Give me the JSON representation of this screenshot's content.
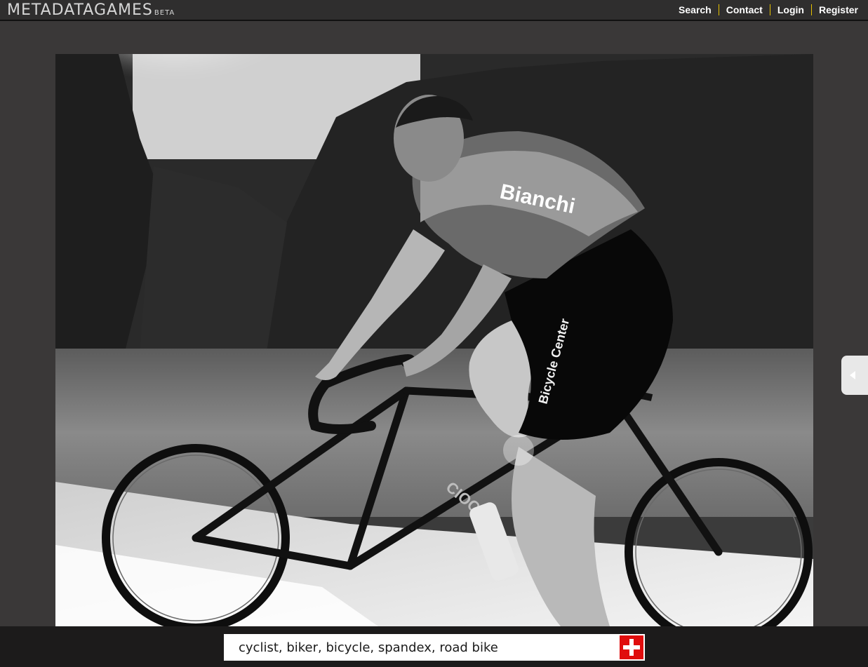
{
  "header": {
    "logo_text": "METADATAGAMES",
    "logo_suffix": "BETA",
    "nav": [
      {
        "label": "Search"
      },
      {
        "label": "Contact"
      },
      {
        "label": "Login"
      },
      {
        "label": "Register"
      }
    ]
  },
  "photo": {
    "jersey_text": "Bianchi",
    "shorts_text": "Bicycle Center",
    "frame_text": "CIOCC"
  },
  "tagging": {
    "input_value": "cyclist, biker, bicycle, spandex, road bike",
    "add_icon": "plus-icon",
    "add_color": "#e00d0d"
  },
  "side_panel": {
    "toggle_icon": "chevron-left-icon"
  },
  "colors": {
    "background": "#3a3838",
    "topbar": "#2f2e2e",
    "bottombar": "#1c1b1b",
    "nav_separator": "#e6c200"
  }
}
